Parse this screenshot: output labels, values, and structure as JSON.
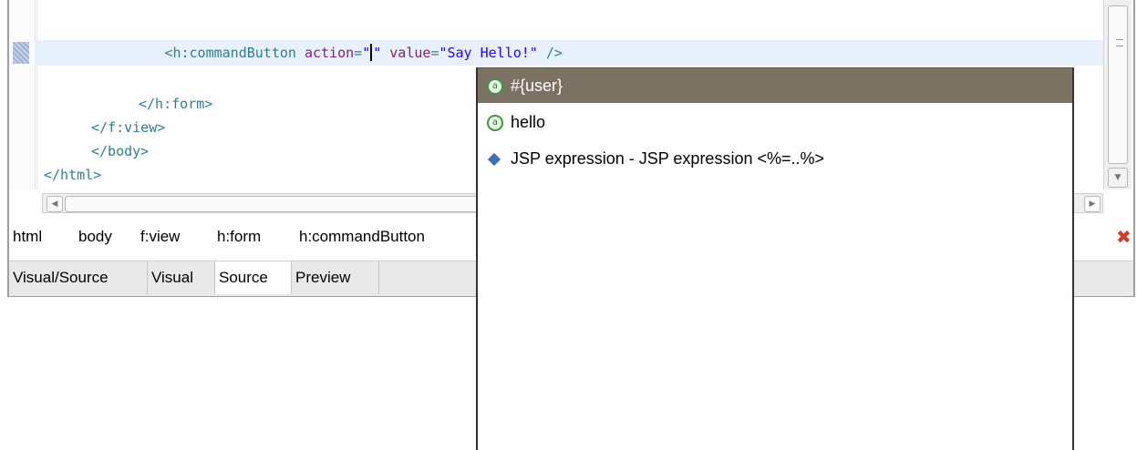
{
  "editor": {
    "code_lines": {
      "button_line": {
        "indent": "              ",
        "tag_open": "<h:commandButton ",
        "attr1": "action",
        "eq1": "=",
        "q1": "\"",
        "q2": "\"",
        "sp": " ",
        "attr2": "value",
        "eq2": "=",
        "val2": "\"Say Hello!\"",
        "tag_close": " />"
      },
      "form_close": "</h:form>",
      "view_close": "</f:view>",
      "body_close": "</body>",
      "html_close": "</html>"
    }
  },
  "breadcrumb": [
    "html",
    "body",
    "f:view",
    "h:form",
    "h:commandButton"
  ],
  "tabs": [
    "Visual/Source",
    "Visual",
    "Source",
    "Preview"
  ],
  "active_tab": "Source",
  "autocomplete": {
    "items": [
      {
        "label": "#{user}",
        "icon": "el-expression-icon",
        "selected": true
      },
      {
        "label": "hello",
        "icon": "el-expression-icon",
        "selected": false
      },
      {
        "label": "JSP expression - JSP expression <%=..%>",
        "icon": "jsp-expression-icon",
        "selected": false
      }
    ]
  },
  "colors": {
    "tag": "#2f7f8f",
    "attribute": "#7f1f7f",
    "string": "#2a00ff",
    "current_line": "#e8f0fc",
    "selection": "#7c7263",
    "close_red": "#d43a2a"
  }
}
